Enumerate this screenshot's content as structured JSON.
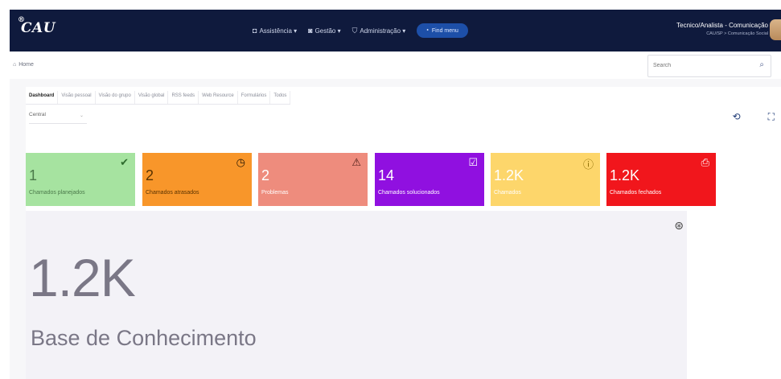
{
  "header": {
    "logo_text": "CAU",
    "logo_ring": "®",
    "menu": [
      {
        "icon": "◘",
        "label": "Assistência ▾"
      },
      {
        "icon": "◙",
        "label": "Gestão ▾"
      },
      {
        "icon": "⛉",
        "label": "Administração ▾"
      }
    ],
    "find_menu_icon": "⬩",
    "find_menu_label": "Find menu",
    "user_name": "Tecnico/Analista - Comunicação",
    "user_entity": "CAU/SP > Comunicação Social"
  },
  "breadcrumb": {
    "home_icon": "⌂",
    "home_label": "Home"
  },
  "search": {
    "placeholder": "Search",
    "icon": "⌕"
  },
  "tabs": [
    "Dashboard",
    "Visão pessoal",
    "Visão do grupo",
    "Visão global",
    "RSS feeds",
    "Web Resource",
    "Formulários",
    "Todos"
  ],
  "context": {
    "value": "Central",
    "chevron": "⌄"
  },
  "toolbar": {
    "refresh_icon": "⟲",
    "fullscreen_icon": "⛶"
  },
  "cards": [
    {
      "value": "1",
      "label": "Chamados planejados",
      "icon": "✔",
      "bg": "#a6e3a0",
      "fg": "#4b7a4a",
      "icon_color": "#2e6b2d"
    },
    {
      "value": "2",
      "label": "Chamados atrasados",
      "icon": "◷",
      "bg": "#f8962a",
      "fg": "#5a3300",
      "icon_color": "#2b1a05"
    },
    {
      "value": "2",
      "label": "Problemas",
      "icon": "⚠",
      "bg": "#ee8c7d",
      "fg": "#ffffff",
      "icon_color": "#4a1d16"
    },
    {
      "value": "14",
      "label": "Chamados solucionados",
      "icon": "☑",
      "bg": "#9010e0",
      "fg": "#ffffff",
      "icon_color": "#ffffff"
    },
    {
      "value": "1.2K",
      "label": "Chamados",
      "icon": "ⓘ",
      "bg": "#fdd66b",
      "fg": "#ffffff",
      "icon_color": "#8a6a00"
    },
    {
      "value": "1.2K",
      "label": "Chamados fechados",
      "icon": "⎙",
      "bg": "#f1161c",
      "fg": "#ffffff",
      "icon_color": "#ffffff"
    }
  ],
  "knowledge_base": {
    "value": "1.2K",
    "label": "Base de Conhecimento",
    "icon": "⊛"
  }
}
